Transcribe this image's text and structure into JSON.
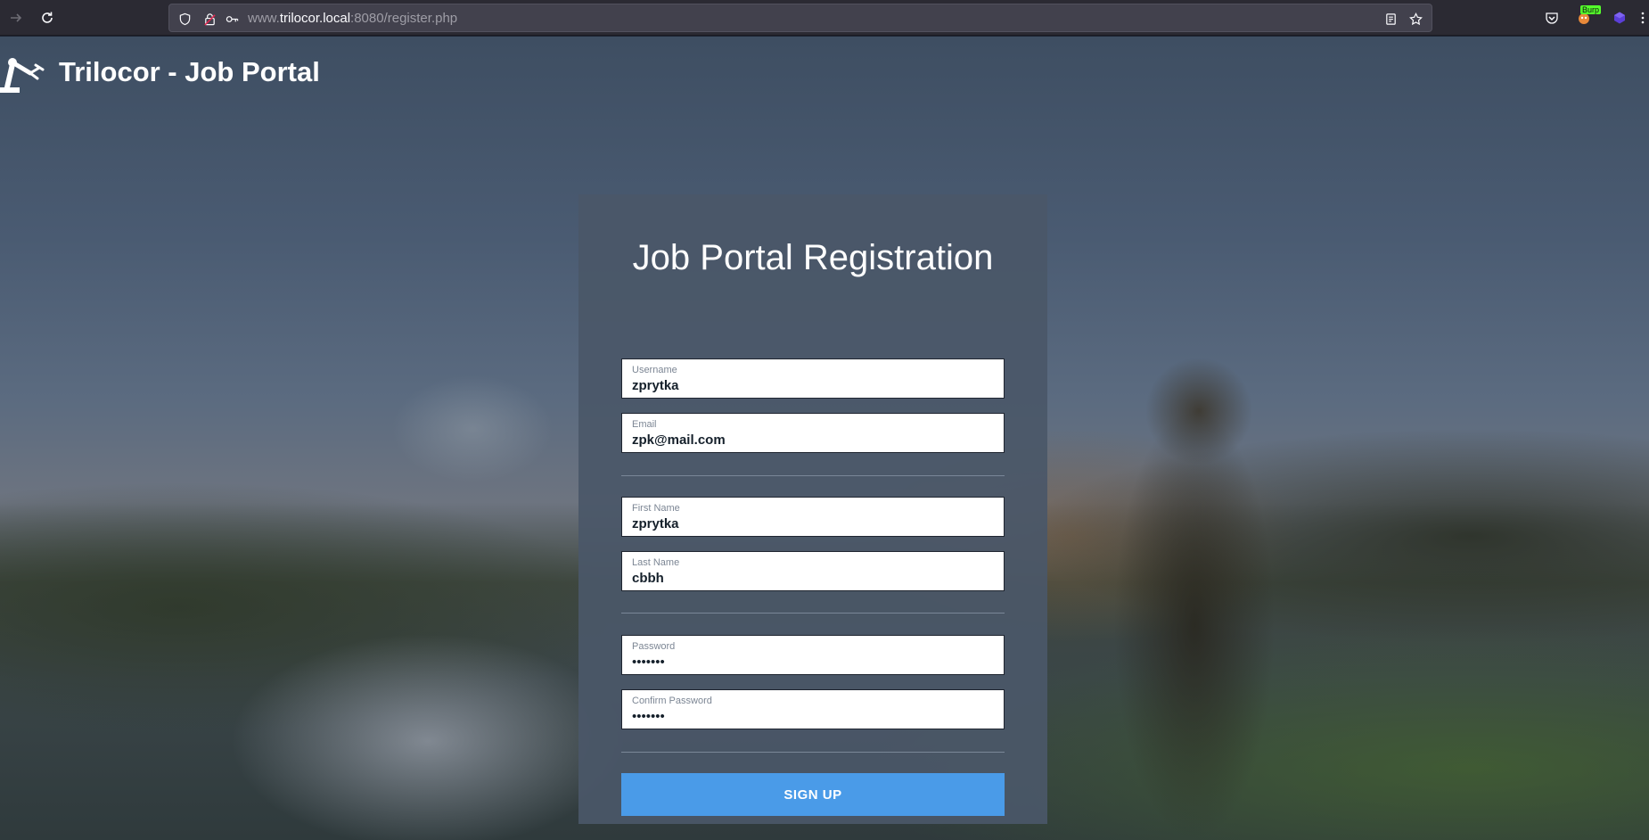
{
  "browser": {
    "url_prefix": "www.",
    "url_host": "trilocor.local",
    "url_suffix": ":8080/register.php",
    "extension_badge": "Burp",
    "icons": {
      "back": "arrow-right-icon",
      "reload": "reload-icon",
      "tracking": "shield-icon",
      "lock": "lock-insecure-icon",
      "key": "key-icon",
      "reader": "reader-view-icon",
      "bookmark": "star-icon",
      "pocket": "pocket-icon",
      "burp": "burp-extension-icon",
      "ext": "extension-cube-icon"
    }
  },
  "header": {
    "title": "Trilocor - Job Portal",
    "logo_icon": "robot-arm-icon"
  },
  "form": {
    "title": "Job Portal Registration",
    "fields": {
      "username": {
        "label": "Username",
        "value": "zprytka"
      },
      "email": {
        "label": "Email",
        "value": "zpk@mail.com"
      },
      "first_name": {
        "label": "First Name",
        "value": "zprytka"
      },
      "last_name": {
        "label": "Last Name",
        "value": "cbbh"
      },
      "password": {
        "label": "Password",
        "value": "•••••••"
      },
      "confirm_password": {
        "label": "Confirm Password",
        "value": "•••••••"
      }
    },
    "submit_label": "SIGN UP"
  },
  "colors": {
    "accent": "#4a9be8",
    "card": "#4a5768",
    "toolbar": "#2b2a33"
  }
}
